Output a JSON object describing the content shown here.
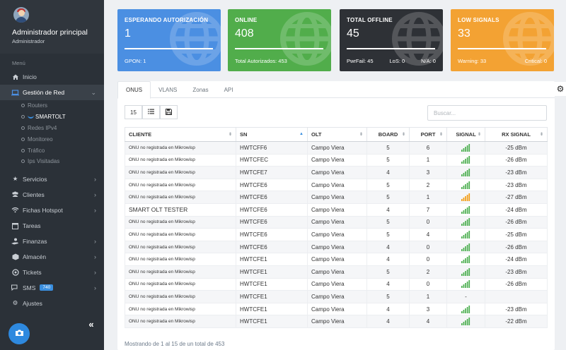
{
  "sidebar": {
    "user_name": "Administrador principal",
    "user_role": "Administrador",
    "menu_label": "Menú",
    "items": [
      {
        "label": "Inicio",
        "icon": "home-icon"
      },
      {
        "label": "Gestión de Red",
        "icon": "laptop-icon",
        "expanded": true
      },
      {
        "label": "Servicios",
        "icon": "star-icon"
      },
      {
        "label": "Clientes",
        "icon": "users-icon"
      },
      {
        "label": "Fichas Hotspot",
        "icon": "wifi-icon"
      },
      {
        "label": "Tareas",
        "icon": "calendar-icon"
      },
      {
        "label": "Finanzas",
        "icon": "hand-money-icon"
      },
      {
        "label": "Almacén",
        "icon": "cube-icon"
      },
      {
        "label": "Tickets",
        "icon": "ticket-icon"
      },
      {
        "label": "SMS",
        "icon": "chat-icon",
        "badge": "740"
      },
      {
        "label": "Ajustes",
        "icon": "cogs-icon"
      }
    ],
    "sub_items": [
      "Routers",
      "SMARTOLT",
      "Redes IPv4",
      "Monitoreo",
      "Tráfico",
      "Ips Visitadas"
    ]
  },
  "cards": {
    "esperando": {
      "title": "ESPERANDO AUTORIZACIÓN",
      "value": "1",
      "foot_left": "GPON: 1",
      "foot_right": "",
      "color": "#4b8fe2"
    },
    "online": {
      "title": "ONLINE",
      "value": "408",
      "foot_left": "Total Autorizados: 453",
      "foot_right": "",
      "color": "#51ad4b"
    },
    "offline": {
      "title": "TOTAL OFFLINE",
      "value": "45",
      "foot_a": "PwrFail: 45",
      "foot_b": "LoS: 0",
      "foot_c": "N/A: 0",
      "color": "#2e3136"
    },
    "low": {
      "title": "LOW SIGNALS",
      "value": "33",
      "foot_left": "Warning: 33",
      "foot_right": "Critical: 0",
      "color": "#f3a233"
    }
  },
  "tabs": [
    "ONUS",
    "VLANS",
    "Zonas",
    "API"
  ],
  "toolbar": {
    "page_size": "15"
  },
  "search": {
    "placeholder": "Buscar..."
  },
  "table": {
    "headers": [
      "CLIENTE",
      "SN",
      "OLT",
      "BOARD",
      "PORT",
      "SIGNAL",
      "RX SIGNAL"
    ],
    "rows": [
      {
        "cliente": "ONU no registrada en Mikrowisp",
        "sn": "HWTCFF6",
        "olt": "Campo Viera",
        "board": "5",
        "port": "6",
        "signal": "good",
        "rx": "-25 dBm"
      },
      {
        "cliente": "ONU no registrada en Mikrowisp",
        "sn": "HWTCFEC",
        "olt": "Campo Viera",
        "board": "5",
        "port": "1",
        "signal": "good",
        "rx": "-26 dBm"
      },
      {
        "cliente": "ONU no registrada en Mikrowisp",
        "sn": "HWTCFE7",
        "olt": "Campo Viera",
        "board": "4",
        "port": "3",
        "signal": "good",
        "rx": "-23 dBm"
      },
      {
        "cliente": "ONU no registrada en Mikrowisp",
        "sn": "HWTCFE6",
        "olt": "Campo Viera",
        "board": "5",
        "port": "2",
        "signal": "good",
        "rx": "-23 dBm"
      },
      {
        "cliente": "ONU no registrada en Mikrowisp",
        "sn": "HWTCFE6",
        "olt": "Campo Viera",
        "board": "5",
        "port": "1",
        "signal": "warning",
        "rx": "-27 dBm"
      },
      {
        "cliente": "SMART OLT TESTER",
        "sn": "HWTCFE6",
        "olt": "Campo Viera",
        "board": "4",
        "port": "7",
        "signal": "good",
        "rx": "-24 dBm"
      },
      {
        "cliente": "ONU no registrada en Mikrowisp",
        "sn": "HWTCFE6",
        "olt": "Campo Viera",
        "board": "5",
        "port": "0",
        "signal": "good",
        "rx": "-26 dBm"
      },
      {
        "cliente": "ONU no registrada en Mikrowisp",
        "sn": "HWTCFE6",
        "olt": "Campo Viera",
        "board": "5",
        "port": "4",
        "signal": "good",
        "rx": "-25 dBm"
      },
      {
        "cliente": "ONU no registrada en Mikrowisp",
        "sn": "HWTCFE6",
        "olt": "Campo Viera",
        "board": "4",
        "port": "0",
        "signal": "good",
        "rx": "-26 dBm"
      },
      {
        "cliente": "ONU no registrada en Mikrowisp",
        "sn": "HWTCFE1",
        "olt": "Campo Viera",
        "board": "4",
        "port": "0",
        "signal": "good",
        "rx": "-24 dBm"
      },
      {
        "cliente": "ONU no registrada en Mikrowisp",
        "sn": "HWTCFE1",
        "olt": "Campo Viera",
        "board": "5",
        "port": "2",
        "signal": "good",
        "rx": "-23 dBm"
      },
      {
        "cliente": "ONU no registrada en Mikrowisp",
        "sn": "HWTCFE1",
        "olt": "Campo Viera",
        "board": "4",
        "port": "0",
        "signal": "good",
        "rx": "-26 dBm"
      },
      {
        "cliente": "ONU no registrada en Mikrowisp",
        "sn": "HWTCFE1",
        "olt": "Campo Viera",
        "board": "5",
        "port": "1",
        "signal": "none",
        "rx": ""
      },
      {
        "cliente": "ONU no registrada en Mikrowisp",
        "sn": "HWTCFE1",
        "olt": "Campo Viera",
        "board": "4",
        "port": "3",
        "signal": "good",
        "rx": "-23 dBm"
      },
      {
        "cliente": "ONU no registrada en Mikrowisp",
        "sn": "HWTCFE1",
        "olt": "Campo Viera",
        "board": "4",
        "port": "4",
        "signal": "good",
        "rx": "-22 dBm"
      }
    ],
    "footer": "Mostrando de 1 al 15 de un total de 453",
    "signal_colors": {
      "good": "#4caf50",
      "warning": "#f39c12"
    }
  }
}
